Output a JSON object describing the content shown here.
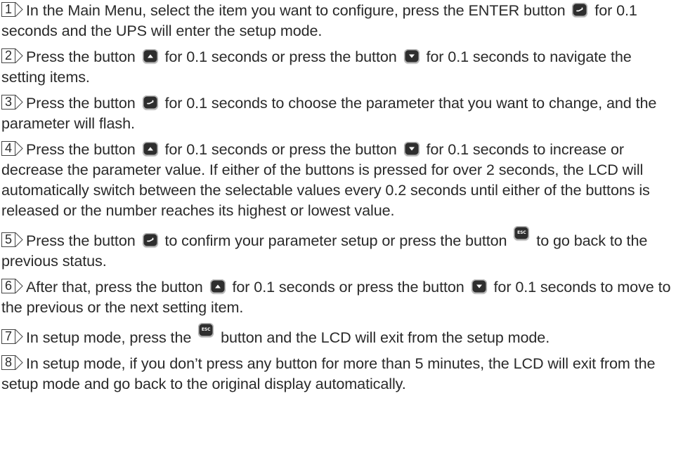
{
  "steps": [
    {
      "num": "1",
      "parts": [
        "In the Main Menu, select the item you want to configure, press the ENTER button",
        "for 0.1 seconds and the UPS will enter the setup mode."
      ]
    },
    {
      "num": "2",
      "parts": [
        "Press the button",
        "for 0.1 seconds or press the button",
        "for 0.1 seconds to navigate the setting items."
      ]
    },
    {
      "num": "3",
      "parts": [
        "Press the button",
        "for 0.1 seconds to choose the parameter that you want to change, and the parameter will flash."
      ]
    },
    {
      "num": "4",
      "parts": [
        "Press the button",
        "for 0.1 seconds or press the button",
        "for 0.1 seconds to increase or decrease the parameter value. If either of the buttons is pressed for over 2 seconds, the LCD will automatically switch between the selectable values every 0.2 seconds until either of the buttons is released or the number reaches its highest or lowest value."
      ]
    },
    {
      "num": "5",
      "parts": [
        "Press the button",
        "to confirm your parameter setup or press the button",
        "to go back to the previous status."
      ]
    },
    {
      "num": "6",
      "parts": [
        "After that, press the button",
        "for 0.1 seconds or press the button",
        "for 0.1 seconds to move to the previous or the next setting item."
      ]
    },
    {
      "num": "7",
      "parts": [
        "In setup mode, press the",
        "button and the LCD will exit from the setup mode."
      ]
    },
    {
      "num": "8",
      "parts": [
        "In setup mode, if you don’t press any button for more than 5 minutes, the LCD will exit from the setup mode and go back to the original display automatically."
      ]
    }
  ],
  "keys": {
    "esc_label": "ESC"
  }
}
